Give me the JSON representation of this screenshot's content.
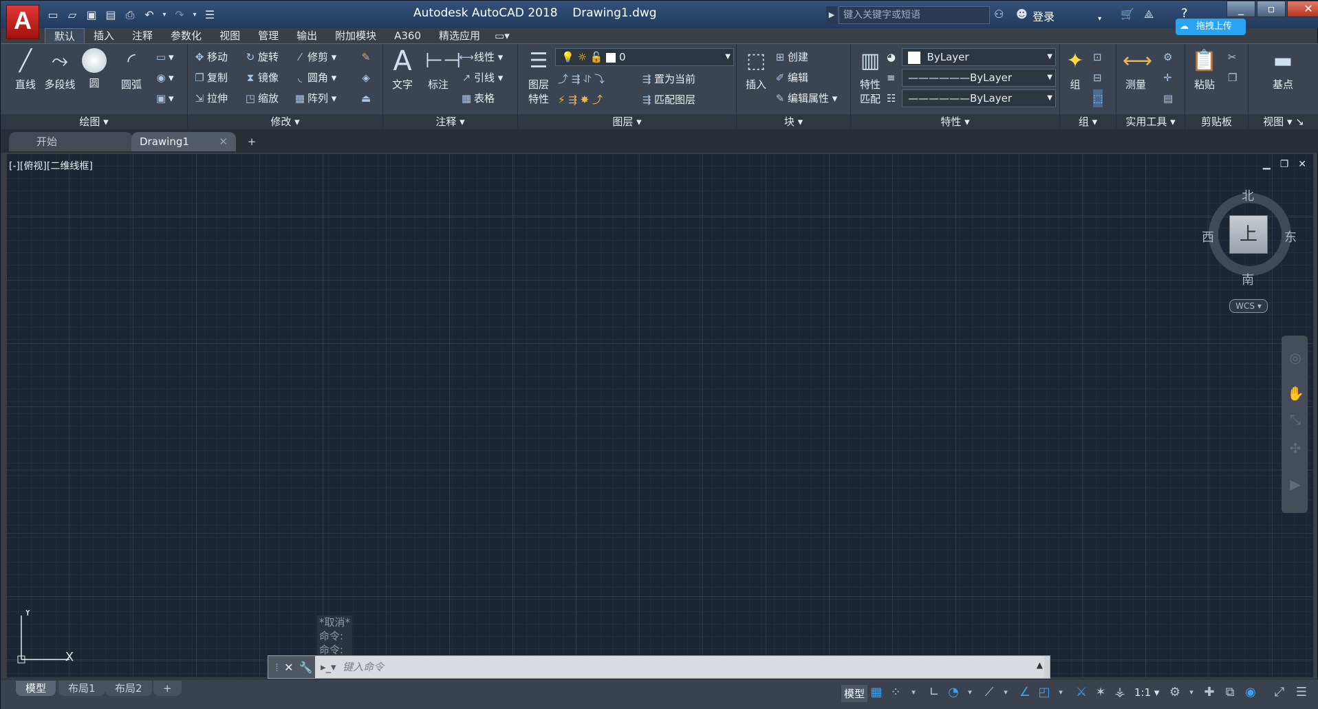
{
  "title": {
    "app": "Autodesk AutoCAD 2018",
    "file": "Drawing1.dwg"
  },
  "search": {
    "placeholder": "键入关键字或短语"
  },
  "account": {
    "login": "登录"
  },
  "badge": {
    "upload": "拖拽上传"
  },
  "menu_tabs": [
    "默认",
    "插入",
    "注释",
    "参数化",
    "视图",
    "管理",
    "输出",
    "附加模块",
    "A360",
    "精选应用"
  ],
  "ribbon": {
    "draw": {
      "title": "绘图",
      "line": "直线",
      "polyline": "多段线",
      "circle": "圆",
      "arc": "圆弧"
    },
    "modify": {
      "title": "修改",
      "move": "移动",
      "rotate": "旋转",
      "trim": "修剪",
      "copy": "复制",
      "mirror": "镜像",
      "fillet": "圆角",
      "stretch": "拉伸",
      "scale": "缩放",
      "array": "阵列"
    },
    "annotation": {
      "title": "注释",
      "text": "文字",
      "dimension": "标注",
      "linear": "线性",
      "leader": "引线",
      "table": "表格"
    },
    "layers": {
      "title": "图层",
      "props1": "图层",
      "props2": "特性",
      "layer_value": "0",
      "set_current": "置为当前",
      "match_layer": "匹配图层"
    },
    "block": {
      "title": "块",
      "insert": "插入",
      "create": "创建",
      "edit": "编辑",
      "edit_attr": "编辑属性"
    },
    "properties": {
      "title": "特性",
      "match1": "特性",
      "match2": "匹配",
      "color": "ByLayer",
      "linetype": "ByLayer",
      "lineweight": "ByLayer"
    },
    "groups": {
      "title": "组",
      "group": "组"
    },
    "utilities": {
      "title": "实用工具",
      "measure": "测量"
    },
    "clipboard": {
      "title": "剪贴板",
      "paste": "粘贴"
    },
    "view": {
      "title": "视图",
      "base": "基点"
    }
  },
  "doc_tabs": {
    "start": "开始",
    "drawing": "Drawing1"
  },
  "viewport": {
    "label": "[-][俯视][二维线框]"
  },
  "viewcube": {
    "north": "北",
    "south": "南",
    "east": "东",
    "west": "西",
    "face": "上",
    "wcs": "WCS"
  },
  "ucs": {
    "x": "X",
    "y": "Y"
  },
  "command": {
    "history": [
      "*取消*",
      "命令:",
      "命令:"
    ],
    "placeholder": "键入命令"
  },
  "layout_tabs": [
    "模型",
    "布局1",
    "布局2"
  ],
  "status": {
    "model": "模型",
    "scale": "1:1"
  }
}
